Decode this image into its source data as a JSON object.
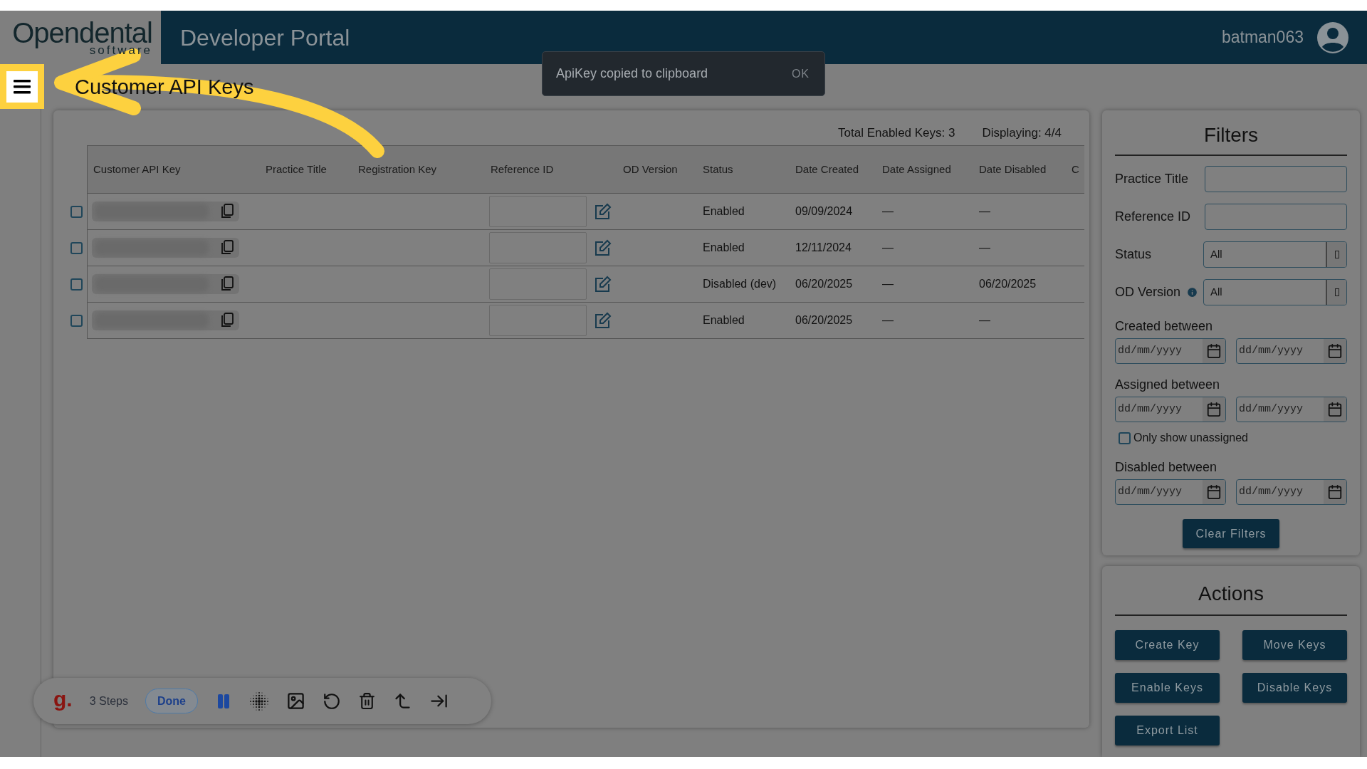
{
  "header": {
    "logo": {
      "name": "Opendental",
      "tagline": "software"
    },
    "title": "Developer Portal",
    "user": "batman063"
  },
  "toast": {
    "message": "ApiKey copied to clipboard",
    "action": "OK"
  },
  "page_title": "Customer API Keys",
  "summary": [
    "Total Enabled Keys: 3",
    "Displaying: 4/4"
  ],
  "table": {
    "columns": [
      "Customer API Key",
      "Practice Title",
      "Registration Key",
      "Reference ID",
      "OD Version",
      "Status",
      "Date Created",
      "Date Assigned",
      "Date Disabled",
      "C"
    ],
    "rows": [
      {
        "checked": false,
        "status": "Enabled",
        "date_created": "09/09/2024",
        "date_assigned": "—",
        "date_disabled": "—"
      },
      {
        "checked": false,
        "status": "Enabled",
        "date_created": "12/11/2024",
        "date_assigned": "—",
        "date_disabled": "—"
      },
      {
        "checked": false,
        "status": "Disabled (dev)",
        "date_created": "06/20/2025",
        "date_assigned": "—",
        "date_disabled": "06/20/2025"
      },
      {
        "checked": false,
        "status": "Enabled",
        "date_created": "06/20/2025",
        "date_assigned": "—",
        "date_disabled": "—"
      }
    ]
  },
  "filters": {
    "title": "Filters",
    "fields": [
      {
        "kind": "text",
        "label": "Practice Title"
      },
      {
        "kind": "text",
        "label": "Reference ID"
      },
      {
        "kind": "select",
        "label": "Status",
        "value": "All",
        "info": false
      },
      {
        "kind": "select",
        "label": "OD Version",
        "value": "All",
        "info": true
      },
      {
        "kind": "daterange",
        "label": "Created between",
        "placeholders": [
          "dd/mm/yyyy",
          "dd/mm/yyyy"
        ]
      },
      {
        "kind": "daterange",
        "label": "Assigned between",
        "placeholders": [
          "dd/mm/yyyy",
          "dd/mm/yyyy"
        ]
      },
      {
        "kind": "checkbox",
        "label": "Only show unassigned",
        "checked": false
      },
      {
        "kind": "daterange",
        "label": "Disabled between",
        "placeholders": [
          "dd/mm/yyyy",
          "dd/mm/yyyy"
        ]
      }
    ],
    "clear_button": "Clear Filters"
  },
  "actions": {
    "title": "Actions",
    "buttons": [
      "Create Key",
      "Move Keys",
      "Enable Keys",
      "Disable Keys",
      "Export List"
    ]
  },
  "recorder": {
    "logo": "g.",
    "steps": "3 Steps",
    "done": "Done"
  }
}
